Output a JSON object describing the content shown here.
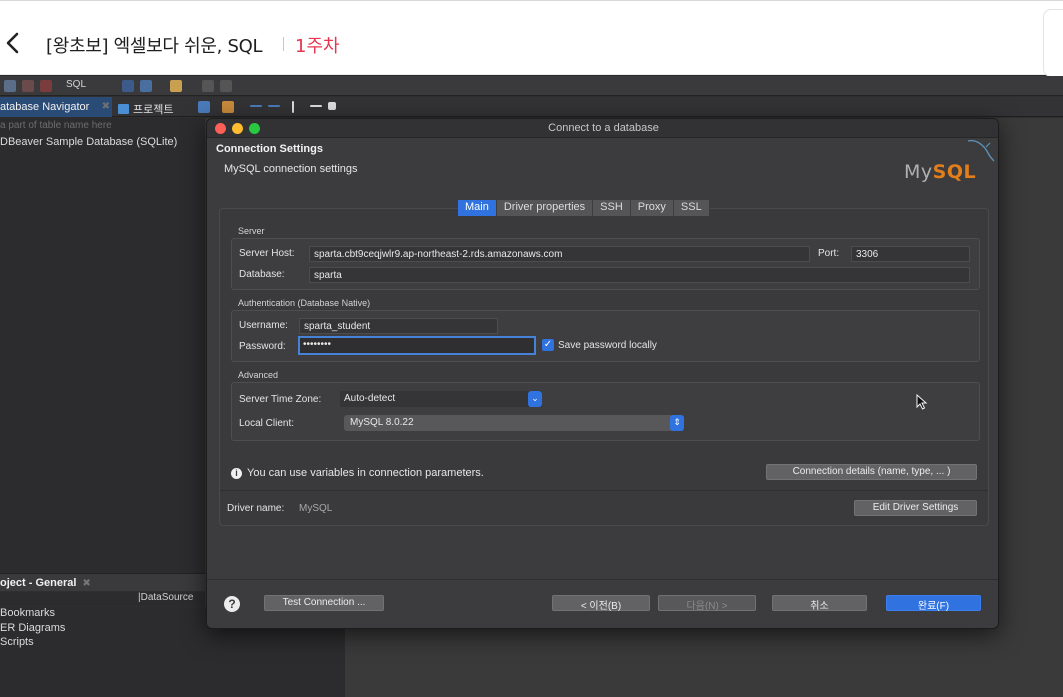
{
  "course": {
    "title": "[왕초보] 엑셀보다 쉬운, SQL",
    "week": "1주차"
  },
  "app": {
    "toolbar": {
      "sql_label": "SQL"
    },
    "views": {
      "navigator_tab": "atabase Navigator",
      "project_tab": "프로젝트",
      "filter_placeholder": "a part of table name here",
      "tree_item": "DBeaver Sample Database (SQLite)"
    },
    "project": {
      "tab": "oject - General",
      "column": "DataSource",
      "items": [
        "Bookmarks",
        "ER Diagrams",
        "Scripts"
      ]
    }
  },
  "dialog": {
    "window_title": "Connect to a database",
    "header_title": "Connection Settings",
    "header_subtitle": "MySQL connection settings",
    "logo_my": "My",
    "logo_sql": "SQL",
    "tabs": [
      {
        "label": "Main",
        "active": true
      },
      {
        "label": "Driver properties",
        "active": false
      },
      {
        "label": "SSH",
        "active": false
      },
      {
        "label": "Proxy",
        "active": false
      },
      {
        "label": "SSL",
        "active": false
      }
    ],
    "server": {
      "group_label": "Server",
      "host_label": "Server Host:",
      "host_value": "sparta.cbt9ceqjwlr9.ap-northeast-2.rds.amazonaws.com",
      "port_label": "Port:",
      "port_value": "3306",
      "database_label": "Database:",
      "database_value": "sparta"
    },
    "auth": {
      "group_label": "Authentication (Database Native)",
      "username_label": "Username:",
      "username_value": "sparta_student",
      "password_label": "Password:",
      "password_value": "••••••••",
      "save_password_label": "Save password locally",
      "save_password_checked": true
    },
    "advanced": {
      "group_label": "Advanced",
      "timezone_label": "Server Time Zone:",
      "timezone_value": "Auto-detect",
      "client_label": "Local Client:",
      "client_value": "MySQL 8.0.22"
    },
    "info_text": "You can use variables in connection parameters.",
    "connection_details_button": "Connection details (name, type, ... )",
    "driver_name_label": "Driver name:",
    "driver_name_value": "MySQL",
    "edit_driver_button": "Edit Driver Settings",
    "footer": {
      "test_connection": "Test Connection ...",
      "back": "< 이전(B)",
      "next": "다음(N) >",
      "cancel": "취소",
      "finish": "완료(F)"
    }
  },
  "colors": {
    "accent_blue": "#2f72e0",
    "week_red": "#e8344e",
    "mysql_orange": "#e37f1a"
  }
}
